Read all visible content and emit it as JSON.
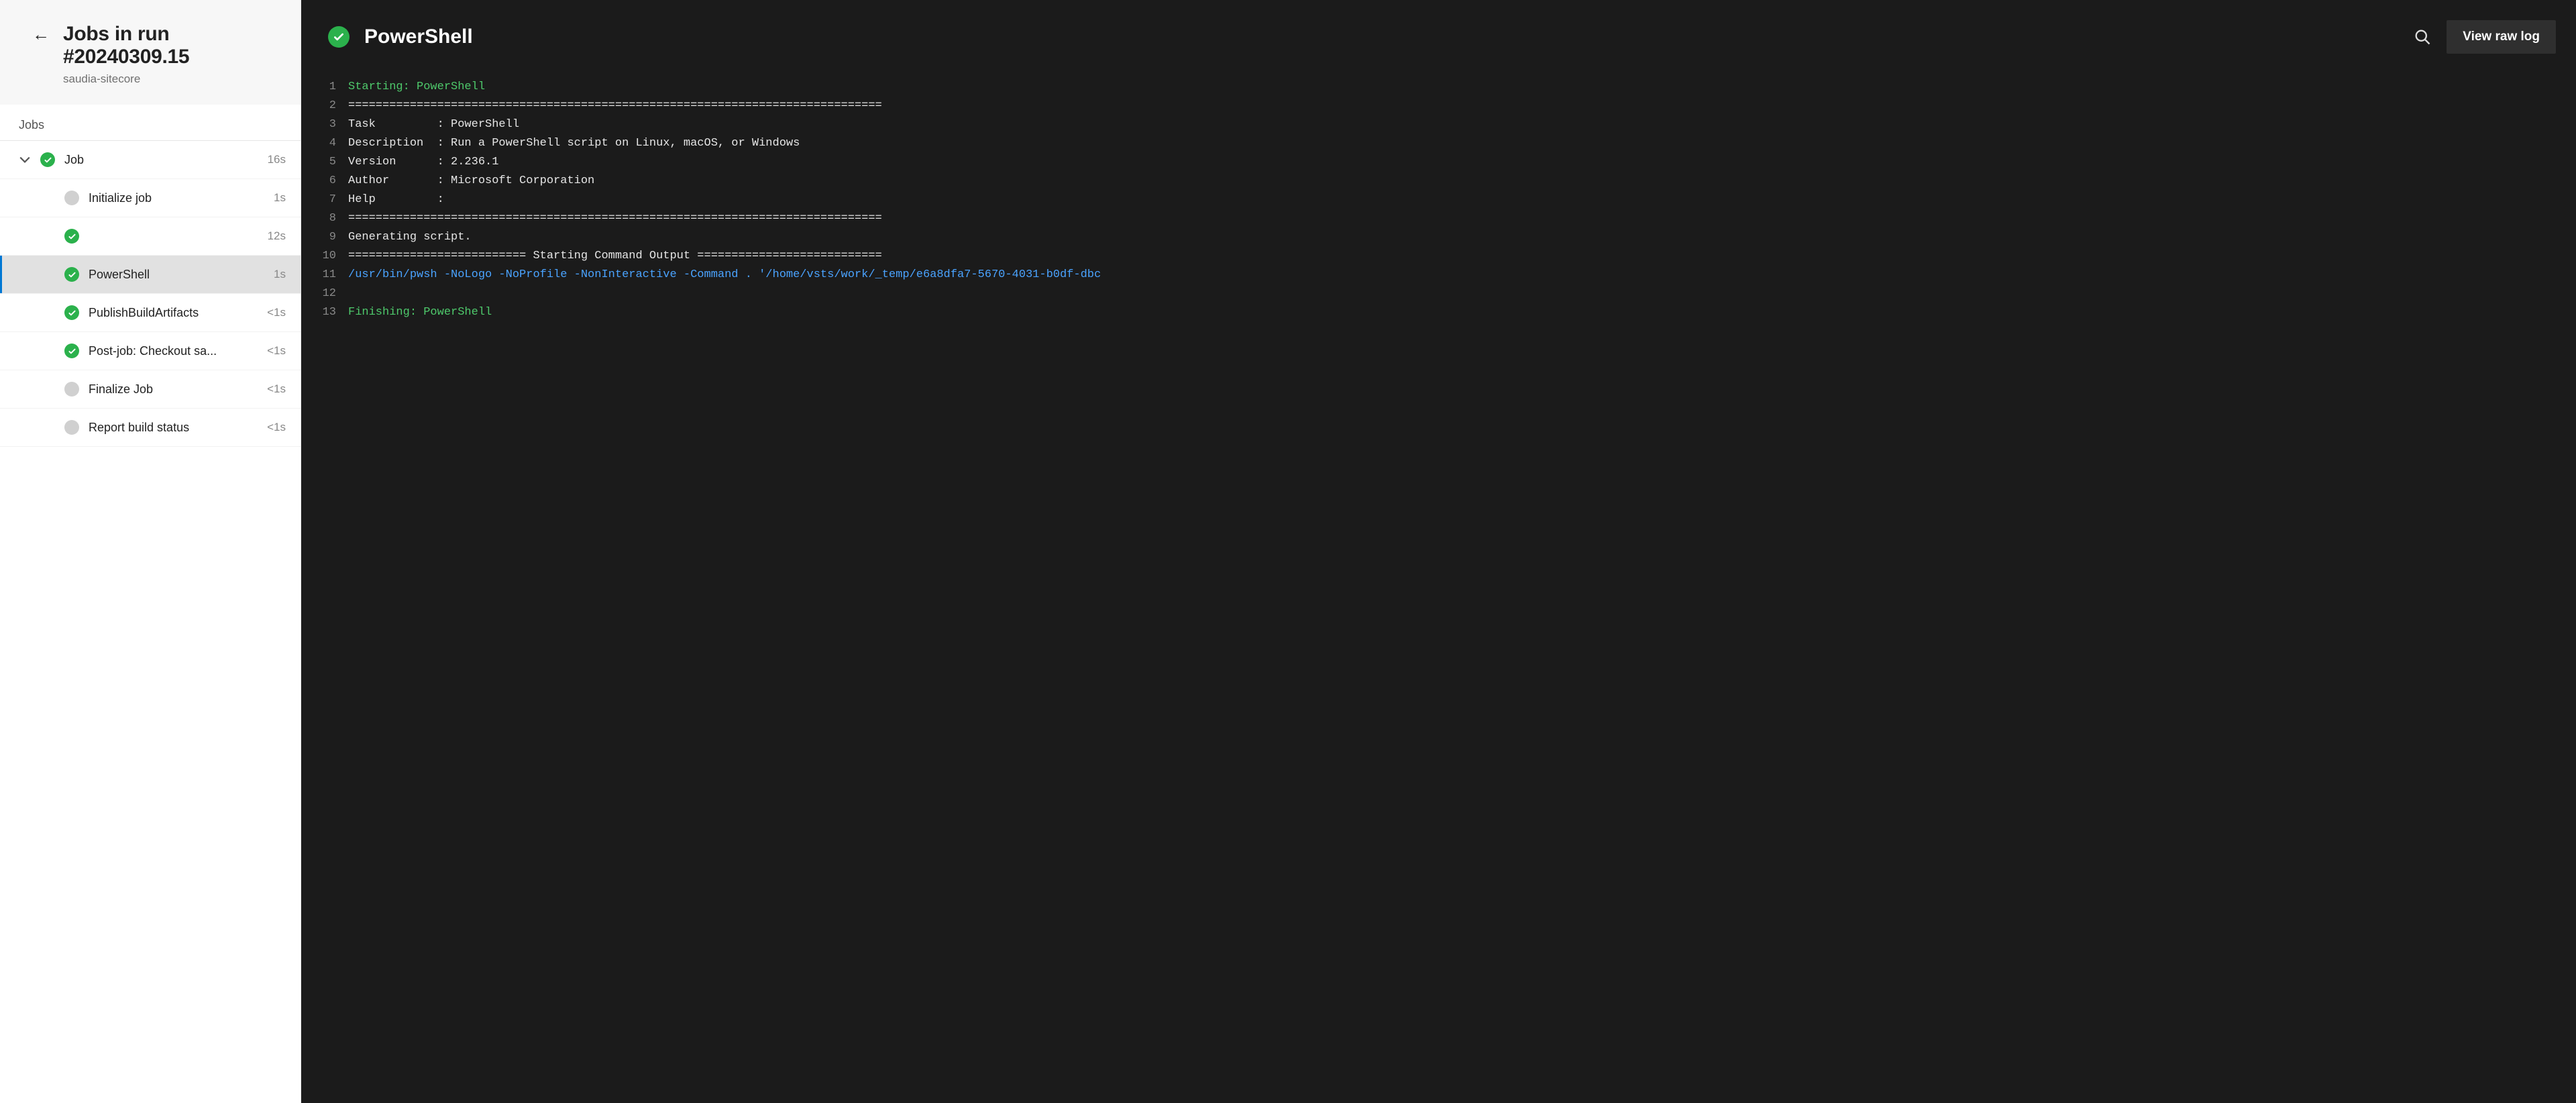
{
  "sidebar": {
    "title": "Jobs in run #20240309.15",
    "subtitle": "saudia-sitecore",
    "section_label": "Jobs",
    "job": {
      "label": "Job",
      "time": "16s"
    },
    "steps": [
      {
        "label": "Initialize job",
        "time": "1s",
        "status": "idle"
      },
      {
        "label": "",
        "time": "12s",
        "status": "ok"
      },
      {
        "label": "PowerShell",
        "time": "1s",
        "status": "ok",
        "selected": true
      },
      {
        "label": "PublishBuildArtifacts",
        "time": "<1s",
        "status": "ok"
      },
      {
        "label": "Post-job: Checkout sa...",
        "time": "<1s",
        "status": "ok"
      },
      {
        "label": "Finalize Job",
        "time": "<1s",
        "status": "idle"
      },
      {
        "label": "Report build status",
        "time": "<1s",
        "status": "idle"
      }
    ]
  },
  "logpane": {
    "title": "PowerShell",
    "view_raw": "View raw log"
  },
  "log": [
    {
      "n": 1,
      "cls": "c-green",
      "text": "Starting: PowerShell"
    },
    {
      "n": 2,
      "cls": "c-white",
      "text": "=============================================================================="
    },
    {
      "n": 3,
      "cls": "c-white",
      "text": "Task         : PowerShell"
    },
    {
      "n": 4,
      "cls": "c-white",
      "text": "Description  : Run a PowerShell script on Linux, macOS, or Windows"
    },
    {
      "n": 5,
      "cls": "c-white",
      "text": "Version      : 2.236.1"
    },
    {
      "n": 6,
      "cls": "c-white",
      "text": "Author       : Microsoft Corporation"
    },
    {
      "n": 7,
      "cls": "c-white",
      "text": "Help         : ",
      "link": "https://docs.microsoft.com/azure/devops/pipelines/tasks/utility/powershell"
    },
    {
      "n": 8,
      "cls": "c-white",
      "text": "=============================================================================="
    },
    {
      "n": 9,
      "cls": "c-white",
      "text": "Generating script."
    },
    {
      "n": 10,
      "cls": "c-white",
      "text": "========================== Starting Command Output ==========================="
    },
    {
      "n": 11,
      "cls": "c-blue",
      "text": "/usr/bin/pwsh -NoLogo -NoProfile -NonInteractive -Command . '/home/vsts/work/_temp/e6a8dfa7-5670-4031-b0df-dbc"
    },
    {
      "n": 12,
      "cls": "c-white",
      "text": ""
    },
    {
      "n": 13,
      "cls": "c-green",
      "text": "Finishing: PowerShell"
    }
  ]
}
